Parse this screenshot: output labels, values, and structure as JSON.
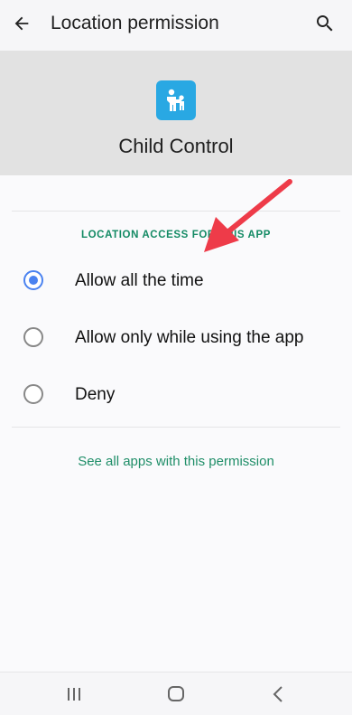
{
  "appbar": {
    "title": "Location permission",
    "back_icon": "arrow-back-icon",
    "search_icon": "search-icon"
  },
  "app_header": {
    "app_icon": "child-control-app-icon",
    "app_name": "Child Control",
    "icon_color": "#29a8e3"
  },
  "section": {
    "header": "LOCATION ACCESS FOR THIS APP"
  },
  "options": [
    {
      "label": "Allow all the time",
      "selected": true
    },
    {
      "label": "Allow only while using the app",
      "selected": false
    },
    {
      "label": "Deny",
      "selected": false
    }
  ],
  "link": {
    "see_all": "See all apps with this permission"
  },
  "annotation": {
    "icon": "red-arrow-annotation",
    "color": "#ee3b49"
  },
  "navbar": {
    "recents_icon": "recents-icon",
    "home_icon": "home-icon",
    "back_icon": "nav-back-icon"
  },
  "colors": {
    "accent_radio": "#4a82f0",
    "section_green": "#138a64",
    "link_green": "#1f8e68"
  }
}
